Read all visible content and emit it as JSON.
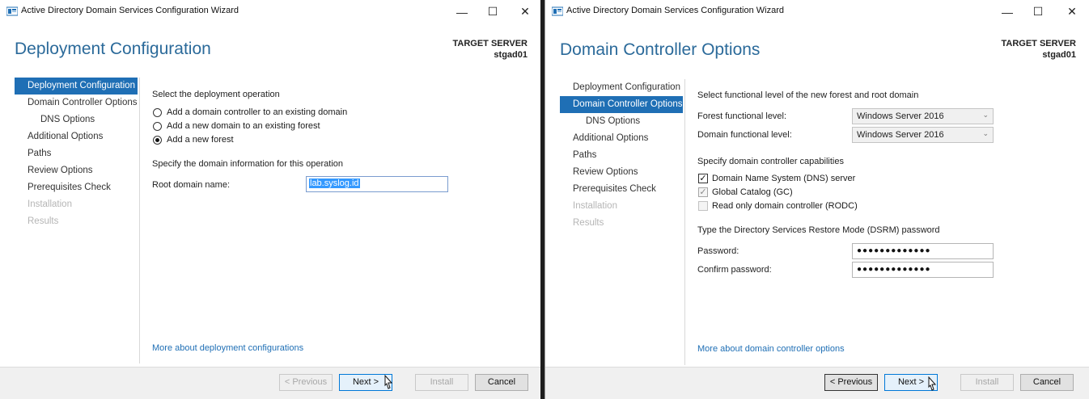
{
  "left_window": {
    "title": "Active Directory Domain Services Configuration Wizard",
    "window_controls": {
      "minimize": "—",
      "maximize": "☐",
      "close": "✕"
    },
    "page_title": "Deployment Configuration",
    "target_server_label": "TARGET SERVER",
    "target_server_name": "stgad01",
    "nav": [
      {
        "label": "Deployment Configuration",
        "state": "selected"
      },
      {
        "label": "Domain Controller Options",
        "state": "normal"
      },
      {
        "label": "DNS Options",
        "state": "sub"
      },
      {
        "label": "Additional Options",
        "state": "normal"
      },
      {
        "label": "Paths",
        "state": "normal"
      },
      {
        "label": "Review Options",
        "state": "normal"
      },
      {
        "label": "Prerequisites Check",
        "state": "normal"
      },
      {
        "label": "Installation",
        "state": "disabled"
      },
      {
        "label": "Results",
        "state": "disabled"
      }
    ],
    "select_operation_label": "Select the deployment operation",
    "operations": [
      {
        "label": "Add a domain controller to an existing domain",
        "checked": false
      },
      {
        "label": "Add a new domain to an existing forest",
        "checked": false
      },
      {
        "label": "Add a new forest",
        "checked": true
      }
    ],
    "domain_info_label": "Specify the domain information for this operation",
    "root_domain_label": "Root domain name:",
    "root_domain_value": "lab.syslog.id",
    "more_link": "More about deployment configurations",
    "buttons": {
      "previous": "< Previous",
      "next": "Next >",
      "install": "Install",
      "cancel": "Cancel"
    }
  },
  "right_window": {
    "title": "Active Directory Domain Services Configuration Wizard",
    "window_controls": {
      "minimize": "—",
      "maximize": "☐",
      "close": "✕"
    },
    "page_title": "Domain Controller Options",
    "target_server_label": "TARGET SERVER",
    "target_server_name": "stgad01",
    "nav": [
      {
        "label": "Deployment Configuration",
        "state": "normal"
      },
      {
        "label": "Domain Controller Options",
        "state": "selected"
      },
      {
        "label": "DNS Options",
        "state": "sub"
      },
      {
        "label": "Additional Options",
        "state": "normal"
      },
      {
        "label": "Paths",
        "state": "normal"
      },
      {
        "label": "Review Options",
        "state": "normal"
      },
      {
        "label": "Prerequisites Check",
        "state": "normal"
      },
      {
        "label": "Installation",
        "state": "disabled"
      },
      {
        "label": "Results",
        "state": "disabled"
      }
    ],
    "functional_level_label": "Select functional level of the new forest and root domain",
    "forest_level_label": "Forest functional level:",
    "forest_level_value": "Windows Server 2016",
    "domain_level_label": "Domain functional level:",
    "domain_level_value": "Windows Server 2016",
    "capabilities_label": "Specify domain controller capabilities",
    "capabilities": [
      {
        "label": "Domain Name System (DNS) server",
        "checked": true,
        "enabled": true
      },
      {
        "label": "Global Catalog (GC)",
        "checked": true,
        "enabled": false
      },
      {
        "label": "Read only domain controller (RODC)",
        "checked": false,
        "enabled": false
      }
    ],
    "dsrm_label": "Type the Directory Services Restore Mode (DSRM) password",
    "password_label": "Password:",
    "password_value": "●●●●●●●●●●●●●",
    "confirm_label": "Confirm password:",
    "confirm_value": "●●●●●●●●●●●●●",
    "more_link": "More about domain controller options",
    "buttons": {
      "previous": "< Previous",
      "next": "Next >",
      "install": "Install",
      "cancel": "Cancel"
    }
  }
}
